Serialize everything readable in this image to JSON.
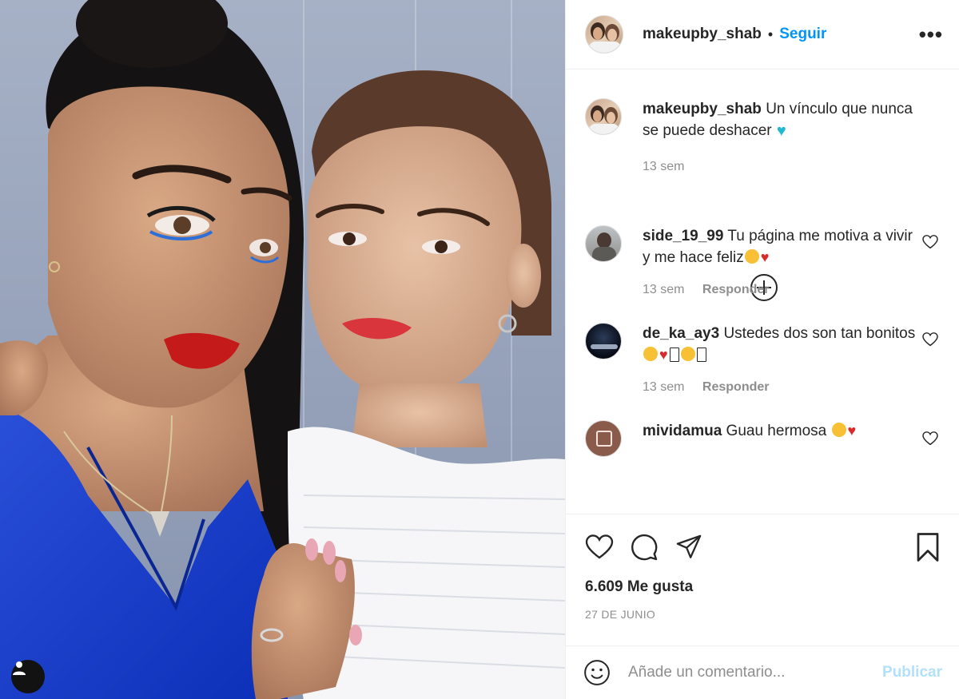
{
  "post": {
    "username": "makeupby_shab",
    "follow_label": "Seguir",
    "separator": "•",
    "more_label": "•••",
    "caption": "Un vínculo que nunca se puede deshacer",
    "caption_time": "13 sem"
  },
  "comments": [
    {
      "username": "side_19_99",
      "text": "Tu página me motiva a vivir y me hace feliz",
      "time": "13 sem",
      "reply": "Responder"
    },
    {
      "username": "de_ka_ay3",
      "text": "Ustedes dos son tan bonitos",
      "time": "13 sem",
      "reply": "Responder"
    },
    {
      "username": "mividamua",
      "text": "Guau hermosa"
    }
  ],
  "likes_text": "6.609 Me gusta",
  "date_text": "27 DE JUNIO",
  "compose": {
    "placeholder": "Añade un comentario...",
    "publish_label": "Publicar"
  },
  "colors": {
    "accent": "#0095f6",
    "publish_disabled": "#b2dffc",
    "meta_gray": "#8e8e8e",
    "text": "#262626"
  },
  "icons": [
    "user-tag-icon",
    "more-options-icon",
    "load-more-icon",
    "heart-icon",
    "comment-icon",
    "share-icon",
    "bookmark-icon",
    "emoji-icon"
  ]
}
